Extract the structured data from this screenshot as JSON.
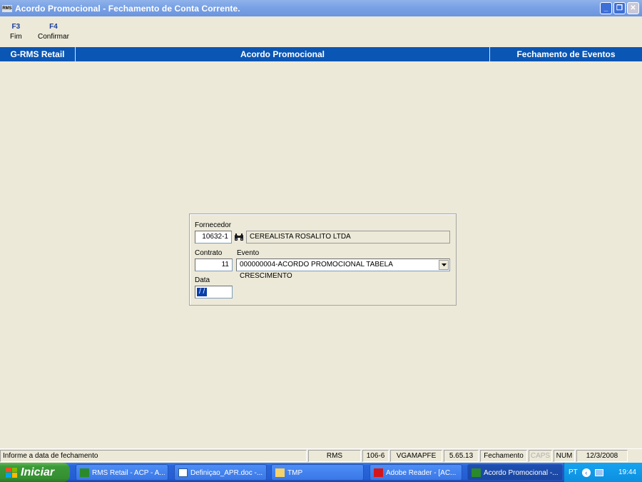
{
  "window": {
    "app_icon_text": "RMS",
    "title": "Acordo Promocional - Fechamento de Conta Corrente."
  },
  "toolbar": {
    "keys": [
      {
        "key": "F3",
        "label": "Fim"
      },
      {
        "key": "F4",
        "label": "Confirmar"
      }
    ]
  },
  "header_band": {
    "left": "G-RMS Retail",
    "center": "Acordo Promocional",
    "right": "Fechamento de Eventos"
  },
  "form": {
    "fornecedor_label": "Fornecedor",
    "fornecedor_code": "10632-1",
    "fornecedor_name": "CEREALISTA ROSALITO LTDA",
    "contrato_label": "Contrato",
    "contrato_value": "11",
    "evento_label": "Evento",
    "evento_value": "000000004-ACORDO PROMOCIONAL TABELA CRESCIMENTO",
    "data_label": "Data",
    "data_value": "/ /"
  },
  "status_bar": {
    "message": "Informe a data de fechamento",
    "cells": [
      "RMS",
      "106-6",
      "VGAMAPFE",
      "5.65.13",
      "Fechamento",
      "CAPS",
      "NUM",
      "12/3/2008"
    ]
  },
  "taskbar": {
    "start_label": "Iniciar",
    "buttons": [
      "RMS Retail - ACP - A...",
      "Definiçao_APR.doc -...",
      "TMP",
      "Adobe Reader - [AC...",
      "Acordo Promocional -..."
    ],
    "tray_lang": "PT",
    "clock": "19:44"
  },
  "colors": {
    "band_blue": "#0a56b4",
    "fkey_blue": "#1a3d9c",
    "title_gradient": "#7ba3e6",
    "taskbar_blue": "#245dd3",
    "start_green": "#3c9a37"
  }
}
